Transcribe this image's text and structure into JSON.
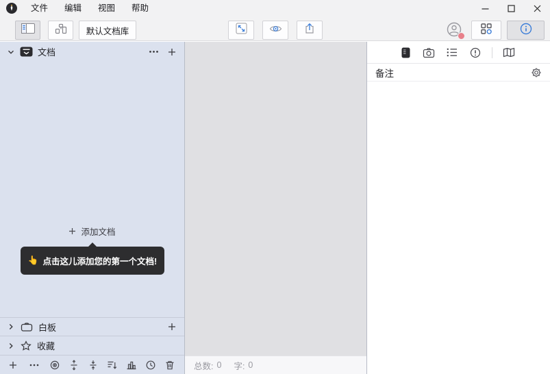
{
  "titlebar": {
    "menus": [
      {
        "label": "文件"
      },
      {
        "label": "编辑"
      },
      {
        "label": "视图"
      },
      {
        "label": "帮助"
      }
    ]
  },
  "toolbar": {
    "library_label": "默认文档库"
  },
  "sidebar": {
    "documents_label": "文档",
    "whiteboard_label": "白板",
    "favorites_label": "收藏",
    "add_document_label": "添加文档",
    "tooltip_emoji": "👆",
    "tooltip_text": "点击这儿添加您的第一个文档!"
  },
  "main": {
    "status": {
      "total_label": "总数:",
      "total_value": "0",
      "words_label": "字:",
      "words_value": "0"
    }
  },
  "inspector": {
    "notes_header": "备注"
  },
  "colors": {
    "accent": "#3b7dd8",
    "badge_red": "#e8808a",
    "sidebar_bg": "#dbe1ee",
    "tooltip_bg": "#2d2d2f"
  }
}
